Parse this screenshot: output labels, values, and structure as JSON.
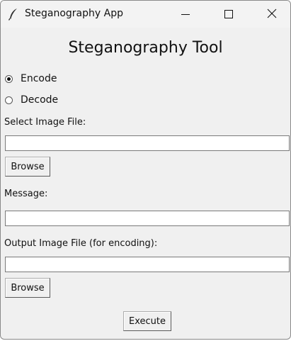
{
  "window": {
    "title": "Steganography App"
  },
  "heading": "Steganography Tool",
  "mode": {
    "options": [
      "Encode",
      "Decode"
    ],
    "selected": "Encode"
  },
  "image_file": {
    "label": "Select Image File:",
    "value": "",
    "browse_label": "Browse"
  },
  "message": {
    "label": "Message:",
    "value": ""
  },
  "output_file": {
    "label": "Output Image File (for encoding):",
    "value": "",
    "browse_label": "Browse"
  },
  "execute_label": "Execute"
}
